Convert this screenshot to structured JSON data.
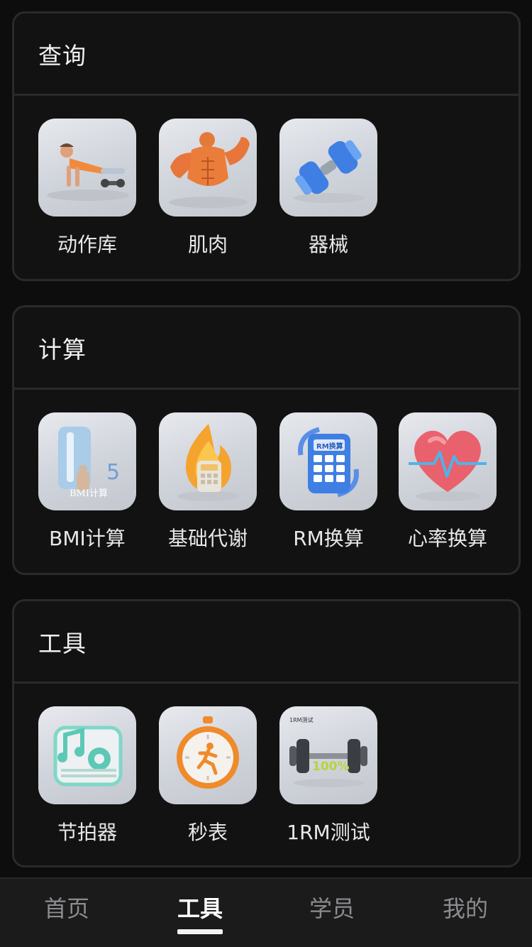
{
  "sections": [
    {
      "title": "查询",
      "items": [
        {
          "label": "动作库",
          "icon": "pushup-figure-icon"
        },
        {
          "label": "肌肉",
          "icon": "muscle-torso-icon"
        },
        {
          "label": "器械",
          "icon": "dumbbell-icon"
        }
      ]
    },
    {
      "title": "计算",
      "items": [
        {
          "label": "BMI计算",
          "icon": "bmi-scale-icon",
          "thumb_text": "BMI计算"
        },
        {
          "label": "基础代谢",
          "icon": "flame-calculator-icon"
        },
        {
          "label": "RM换算",
          "icon": "rm-calculator-icon",
          "thumb_text": "RM换算"
        },
        {
          "label": "心率换算",
          "icon": "heart-rate-icon"
        }
      ]
    },
    {
      "title": "工具",
      "items": [
        {
          "label": "节拍器",
          "icon": "metronome-music-icon"
        },
        {
          "label": "秒表",
          "icon": "stopwatch-icon"
        },
        {
          "label": "1RM测试",
          "icon": "barbell-icon",
          "thumb_text": "100%",
          "thumb_caption": "1RM测试"
        }
      ]
    }
  ],
  "tabbar": {
    "tabs": [
      {
        "label": "首页",
        "active": false
      },
      {
        "label": "工具",
        "active": true
      },
      {
        "label": "学员",
        "active": false
      },
      {
        "label": "我的",
        "active": false
      }
    ]
  },
  "colors": {
    "background": "#0d0d0d",
    "card_border": "#2a2a2c",
    "tab_active": "#ffffff",
    "tab_inactive": "#8c8c8f"
  }
}
